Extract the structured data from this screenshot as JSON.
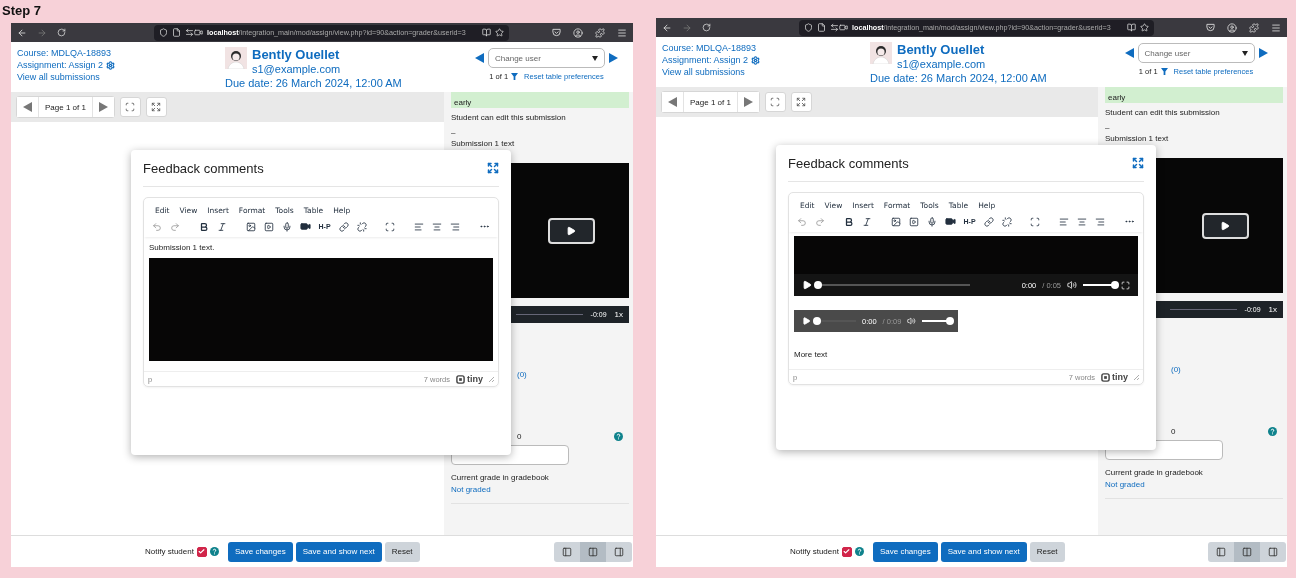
{
  "step_title": "Step 7",
  "screens": [
    {
      "browser": {
        "url_host": "localhost",
        "url_path": "/integration_main/mod/assign/view.php?id=90&action=grader&userid=3"
      },
      "header": {
        "course": "Course: MDLQA-18893",
        "assignment": "Assignment: Assign 2",
        "view_all": "View all submissions",
        "user_name": "Bently Ouellet",
        "email": "s1@example.com",
        "due_date": "Due date: 26 March 2024, 12:00 AM",
        "change_user": {
          "placeholder": "Change user"
        },
        "count": "1 of 1",
        "reset": "Reset table preferences"
      },
      "pager": "Page 1 of 1",
      "sidebar": {
        "status": "early",
        "can_edit": "Student can edit this submission",
        "dash": "–",
        "submission_heading": "Submission 1 text",
        "video": {
          "time": "-0:09",
          "speed": "1x"
        },
        "comments_count": "(0)",
        "grade_label": "0",
        "current_grade_label": "Current grade in gradebook",
        "current_grade": "Not graded"
      },
      "modal": {
        "title": "Feedback comments",
        "menu": [
          "Edit",
          "View",
          "Insert",
          "Format",
          "Tools",
          "Table",
          "Help"
        ],
        "h5p_button": "H-P",
        "content": [
          {
            "kind": "text",
            "text": "Submission 1 text."
          },
          {
            "kind": "video"
          }
        ],
        "path": "p",
        "word_count": "7 words",
        "brand": "tiny"
      },
      "footer": {
        "notify": {
          "label": "Notify student",
          "checked": true
        },
        "buttons": [
          {
            "label": "Save changes",
            "kind": "primary"
          },
          {
            "label": "Save and show next",
            "kind": "primary"
          },
          {
            "label": "Reset",
            "kind": "secondary"
          }
        ],
        "layouts": [
          {
            "selected": false
          },
          {
            "selected": true
          },
          {
            "selected": false
          }
        ]
      }
    },
    {
      "browser": {
        "url_host": "localhost",
        "url_path": "/integration_main/mod/assign/view.php?id=90&action=grader&userid=3"
      },
      "header": {
        "course": "Course: MDLQA-18893",
        "assignment": "Assignment: Assign 2",
        "view_all": "View all submissions",
        "user_name": "Bently Ouellet",
        "email": "s1@example.com",
        "due_date": "Due date: 26 March 2024, 12:00 AM",
        "change_user": {
          "placeholder": "Change user"
        },
        "count": "1 of 1",
        "reset": "Reset table preferences"
      },
      "pager": "Page 1 of 1",
      "sidebar": {
        "status": "early",
        "can_edit": "Student can edit this submission",
        "dash": "–",
        "submission_heading": "Submission 1 text",
        "video": {
          "time": "-0:09",
          "speed": "1x"
        },
        "comments_count": "(0)",
        "grade_label": "0",
        "current_grade_label": "Current grade in gradebook",
        "current_grade": "Not graded"
      },
      "modal": {
        "title": "Feedback comments",
        "menu": [
          "Edit",
          "View",
          "Insert",
          "Format",
          "Tools",
          "Table",
          "Help"
        ],
        "h5p_button": "H-P",
        "content": [
          {
            "kind": "video",
            "time": "0:00",
            "duration": "/ 0:05",
            "progress": {
              "level": 0
            },
            "volume": {
              "level": 1
            }
          },
          {
            "kind": "audio",
            "time": "0:00",
            "duration": "/ 0:09",
            "progress": {
              "level": 0
            },
            "volume": {
              "level": 1
            }
          },
          {
            "kind": "text",
            "text": "More text"
          }
        ],
        "path": "p",
        "word_count": "7 words",
        "brand": "tiny"
      },
      "footer": {
        "notify": {
          "label": "Notify student",
          "checked": true
        },
        "buttons": [
          {
            "label": "Save changes",
            "kind": "primary"
          },
          {
            "label": "Save and show next",
            "kind": "primary"
          },
          {
            "label": "Reset",
            "kind": "secondary"
          }
        ],
        "layouts": [
          {
            "selected": false
          },
          {
            "selected": true
          },
          {
            "selected": false
          }
        ]
      }
    }
  ]
}
